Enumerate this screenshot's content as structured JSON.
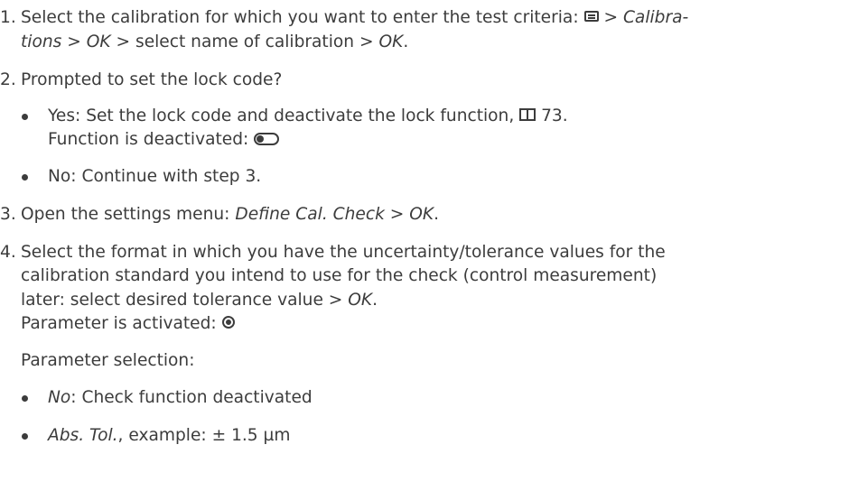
{
  "steps": {
    "s1": {
      "num": "1.",
      "line1_a": "Select the calibration for which you want to enter the test criteria:",
      "line1_b": ">",
      "line1_c": "Calibra-",
      "line2_a": "tions",
      "line2_b": ">",
      "line2_c": "OK",
      "line2_d": "> select name of calibration >",
      "line2_e": "OK",
      "line2_f": ".",
      "menu_icon": "menu-icon"
    },
    "s2": {
      "num": "2.",
      "text": "Prompted to set the lock code?",
      "yes_line1": "Yes: Set the lock code and deactivate the lock function,",
      "yes_page": "73.",
      "yes_line2": "Function is deactivated:",
      "no_text": "No: Continue with step 3.",
      "book_icon": "book-icon",
      "toggle_icon": "toggle-off-icon"
    },
    "s3": {
      "num": "3.",
      "text_a": "Open the settings menu:",
      "text_b": "Define Cal. Check",
      "text_c": ">",
      "text_d": "OK",
      "text_e": "."
    },
    "s4": {
      "num": "4.",
      "line1": "Select the format in which you have the uncertainty/tolerance values for the",
      "line2": "calibration standard you intend to use for the check (control measurement)",
      "line3_a": "later: select desired tolerance value >",
      "line3_b": "OK",
      "line3_c": ".",
      "line4": "Parameter is activated:",
      "radio_icon": "radio-selected-icon",
      "sel_heading": "Parameter selection:",
      "opt1_a": "No",
      "opt1_b": ": Check function deactivated",
      "opt2_a": "Abs. Tol.",
      "opt2_b": ", example: ± 1.5 µm"
    }
  }
}
